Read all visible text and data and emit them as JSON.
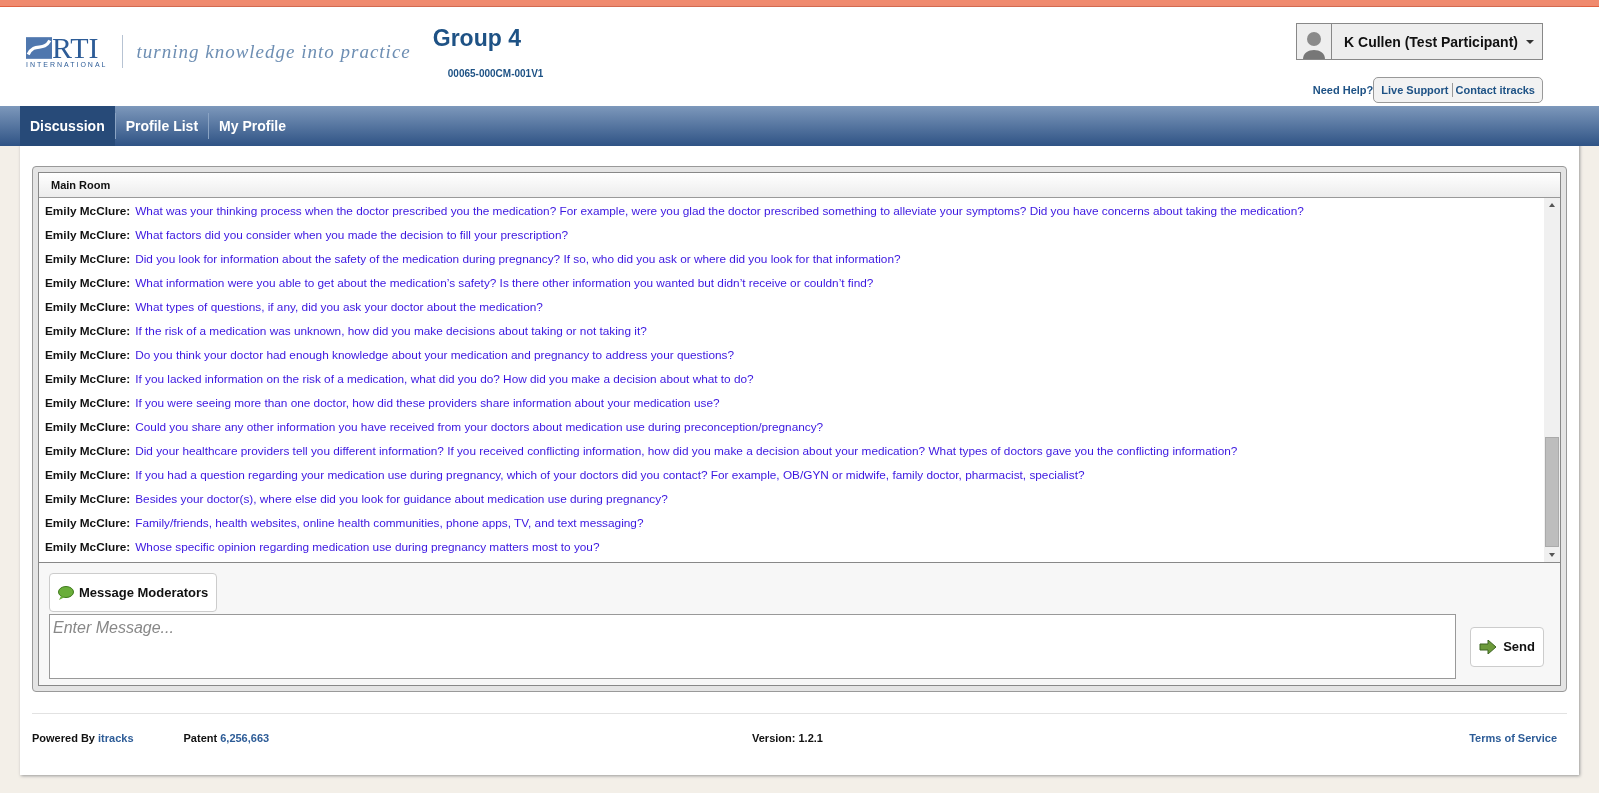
{
  "header": {
    "logo": {
      "mark": "RTI",
      "subtitle": "INTERNATIONAL"
    },
    "tagline": "turning knowledge into practice",
    "group_title": "Group 4",
    "project_code": "00065-000CM-001V1",
    "user_menu": {
      "label": "K Cullen (Test Participant)"
    },
    "help": {
      "label": "Need Help?",
      "links": [
        "Live Support",
        "Contact itracks"
      ]
    }
  },
  "tabs": [
    {
      "label": "Discussion",
      "selected": true
    },
    {
      "label": "Profile List",
      "selected": false
    },
    {
      "label": "My Profile",
      "selected": false
    }
  ],
  "room": {
    "title": "Main Room",
    "messages": [
      {
        "author": "Emily McClure:",
        "text": "What was your thinking process when the doctor prescribed you the medication? For example, were you glad the doctor prescribed something to alleviate your symptoms? Did you have concerns about taking the medication?"
      },
      {
        "author": "Emily McClure:",
        "text": "What factors did you consider when you made the decision to fill your prescription?"
      },
      {
        "author": "Emily McClure:",
        "text": "Did you look for information about the safety of the medication during pregnancy? If so, who did you ask or where did you look for that information?"
      },
      {
        "author": "Emily McClure:",
        "text": "What information were you able to get about the medication’s safety? Is there other information you wanted but didn’t receive or couldn’t find?"
      },
      {
        "author": "Emily McClure:",
        "text": "What types of questions, if any, did you ask your doctor about the medication?"
      },
      {
        "author": "Emily McClure:",
        "text": "If the risk of a medication was unknown, how did you make decisions about taking or not taking it?"
      },
      {
        "author": "Emily McClure:",
        "text": "Do you think your doctor had enough knowledge about your medication and pregnancy to address your questions?"
      },
      {
        "author": "Emily McClure:",
        "text": "If you lacked information on the risk of a medication, what did you do? How did you make a decision about what to do?"
      },
      {
        "author": "Emily McClure:",
        "text": "If you were seeing more than one doctor, how did these providers share information about your medication use?"
      },
      {
        "author": "Emily McClure:",
        "text": "Could you share any other information you have received from your doctors about medication use during preconception/pregnancy?"
      },
      {
        "author": "Emily McClure:",
        "text": "Did your healthcare providers tell you different information? If you received conflicting information, how did you make a decision about your medication? What types of doctors gave you the conflicting information?"
      },
      {
        "author": "Emily McClure:",
        "text": "If you had a question regarding your medication use during pregnancy, which of your doctors did you contact? For example, OB/GYN or midwife, family doctor, pharmacist, specialist?"
      },
      {
        "author": "Emily McClure:",
        "text": "Besides your doctor(s), where else did you look for guidance about medication use during pregnancy?"
      },
      {
        "author": "Emily McClure:",
        "text": "Family/friends, health websites, online health communities, phone apps, TV, and text messaging?"
      },
      {
        "author": "Emily McClure:",
        "text": "Whose specific opinion regarding medication use during pregnancy matters most to you?"
      }
    ],
    "moderator_button": "Message Moderators",
    "message_field": {
      "placeholder": "Enter Message..."
    },
    "send_button": "Send"
  },
  "footer": {
    "powered_by": {
      "label": "Powered By",
      "link": "itracks"
    },
    "patent": {
      "label": "Patent",
      "link": "6,256,663"
    },
    "version": "Version: 1.2.1",
    "terms": "Terms of Service"
  }
}
